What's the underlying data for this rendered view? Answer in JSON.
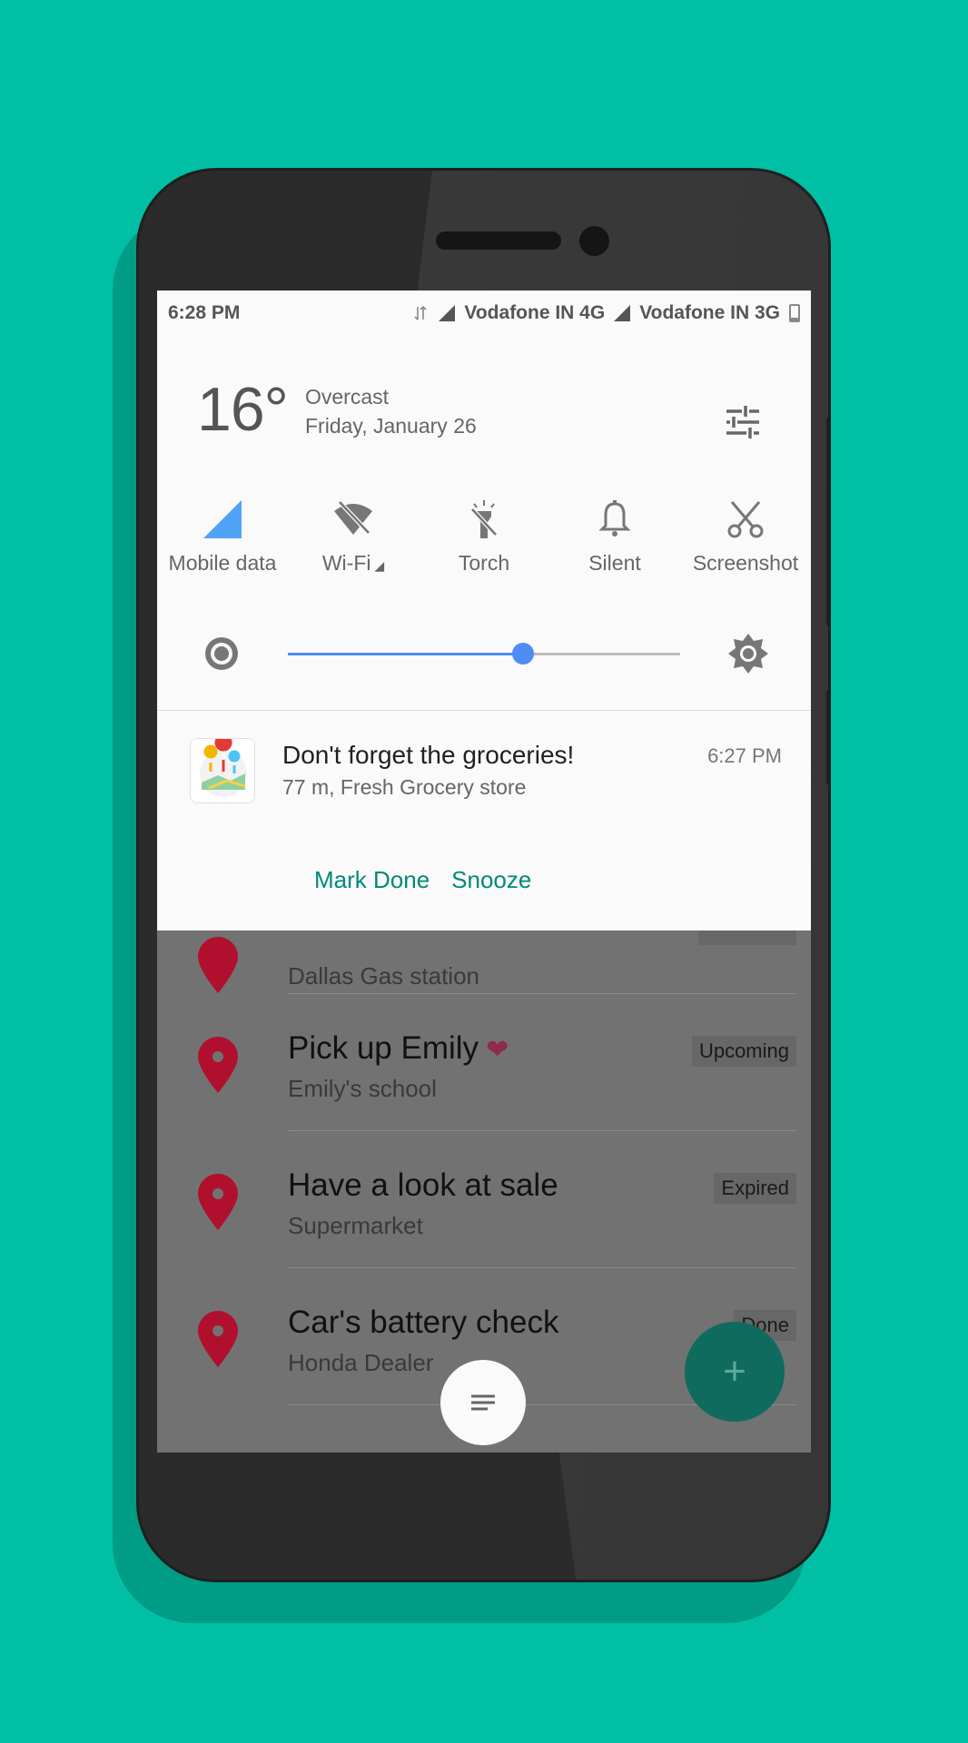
{
  "status_bar": {
    "time": "6:28 PM",
    "carrier1": "Vodafone IN 4G",
    "carrier2": "Vodafone IN 3G"
  },
  "weather": {
    "temperature": "16°",
    "condition": "Overcast",
    "date": "Friday, January 26"
  },
  "tiles": [
    {
      "label": "Mobile data",
      "icon": "mobile-data-icon"
    },
    {
      "label": "Wi-Fi",
      "icon": "wifi-off-icon"
    },
    {
      "label": "Torch",
      "icon": "torch-off-icon"
    },
    {
      "label": "Silent",
      "icon": "bell-icon"
    },
    {
      "label": "Screenshot",
      "icon": "scissors-icon"
    }
  ],
  "brightness": {
    "level": 0.6
  },
  "notification": {
    "title": "Don't forget the groceries!",
    "subtitle": "77 m, Fresh Grocery store",
    "time": "6:27 PM",
    "actions": [
      "Mark Done",
      "Snooze"
    ]
  },
  "reminders": [
    {
      "title": "",
      "place": "Dallas Gas station",
      "status": ""
    },
    {
      "title": "Pick up Emily",
      "place": "Emily's school",
      "status": "Upcoming"
    },
    {
      "title": "Have a look at sale",
      "place": "Supermarket",
      "status": "Expired"
    },
    {
      "title": "Car's battery check",
      "place": "Honda Dealer",
      "status": "Done"
    }
  ],
  "colors": {
    "background": "#00bfa5",
    "accent": "#00897b",
    "slider": "#4e8cf4",
    "pin": "#b0102d"
  }
}
